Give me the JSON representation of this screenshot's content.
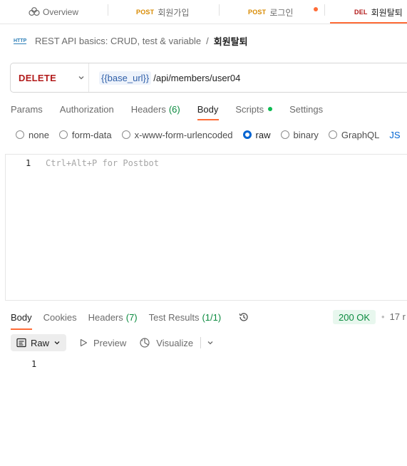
{
  "tabs": [
    {
      "method": "",
      "label": "Overview",
      "icon": "overview-icon"
    },
    {
      "method": "POST",
      "label": "회원가입"
    },
    {
      "method": "POST",
      "label": "로그인"
    },
    {
      "method": "DEL",
      "label": "회원탈퇴"
    }
  ],
  "breadcrumb": {
    "icon": "http-icon",
    "icon_text": "HTTP",
    "collection": "REST API basics: CRUD, test & variable",
    "separator": "/",
    "current": "회원탈퇴"
  },
  "request": {
    "method": "DELETE",
    "url_variable": "{{base_url}}",
    "url_path": "/api/members/user04"
  },
  "request_tabs": {
    "params": "Params",
    "authorization": "Authorization",
    "headers": "Headers",
    "headers_count": "(6)",
    "body": "Body",
    "scripts": "Scripts",
    "settings": "Settings"
  },
  "body_types": {
    "none": "none",
    "form_data": "form-data",
    "urlencoded": "x-www-form-urlencoded",
    "raw": "raw",
    "binary": "binary",
    "graphql": "GraphQL",
    "json": "JS"
  },
  "editor": {
    "line_number": "1",
    "placeholder": "Ctrl+Alt+P for Postbot"
  },
  "response_tabs": {
    "body": "Body",
    "cookies": "Cookies",
    "headers": "Headers",
    "headers_count": "(7)",
    "test_results": "Test Results",
    "test_results_count": "(1/1)"
  },
  "response": {
    "status": "200 OK",
    "separator": "•",
    "time": "17 r",
    "line_number": "1"
  },
  "response_toolbar": {
    "raw": "Raw",
    "preview": "Preview",
    "visualize": "Visualize"
  },
  "colors": {
    "accent": "#ff6c37",
    "delete_method": "#b21a1a",
    "post_method": "#d88a00",
    "success": "#0a8a3e",
    "link_blue": "#0265d2"
  }
}
